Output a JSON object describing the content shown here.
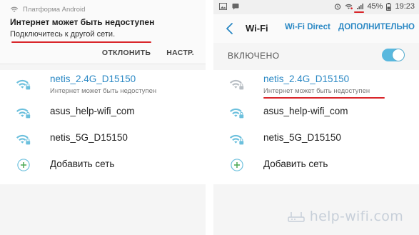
{
  "left": {
    "notification": {
      "app_name": "Платформа Android",
      "title": "Интернет может быть недоступен",
      "text": "Подключитесь к другой сети.",
      "action_dismiss": "ОТКЛОНИТЬ",
      "action_settings": "НАСТР."
    },
    "networks": [
      {
        "name": "netis_2.4G_D15150",
        "subtitle": "Интернет может быть недоступен",
        "icon": "wifi-lock-icon",
        "active": true
      },
      {
        "name": "asus_help-wifi_com",
        "icon": "wifi-lock-icon"
      },
      {
        "name": "netis_5G_D15150",
        "icon": "wifi-lock-icon"
      }
    ],
    "add_network": "Добавить сеть"
  },
  "right": {
    "status_bar": {
      "battery": "45%",
      "time": "19:23"
    },
    "header": {
      "title": "Wi-Fi",
      "tab_direct": "Wi-Fi Direct",
      "tab_more": "ДОПОЛНИТЕЛЬНО"
    },
    "toggle_label": "ВКЛЮЧЕНО",
    "toggle_on": true,
    "networks": [
      {
        "name": "netis_2.4G_D15150",
        "subtitle": "Интернет может быть недоступен",
        "icon": "wifi-lock-icon",
        "active": true
      },
      {
        "name": "asus_help-wifi_com",
        "icon": "wifi-lock-icon"
      },
      {
        "name": "netis_5G_D15150",
        "icon": "wifi-lock-icon"
      }
    ],
    "add_network": "Добавить сеть"
  },
  "watermark": "help-wifi.com",
  "colors": {
    "accent": "#2a88c4",
    "wifi_icon": "#6cc0dd",
    "toggle": "#59b8de",
    "highlight": "#d9262b"
  }
}
